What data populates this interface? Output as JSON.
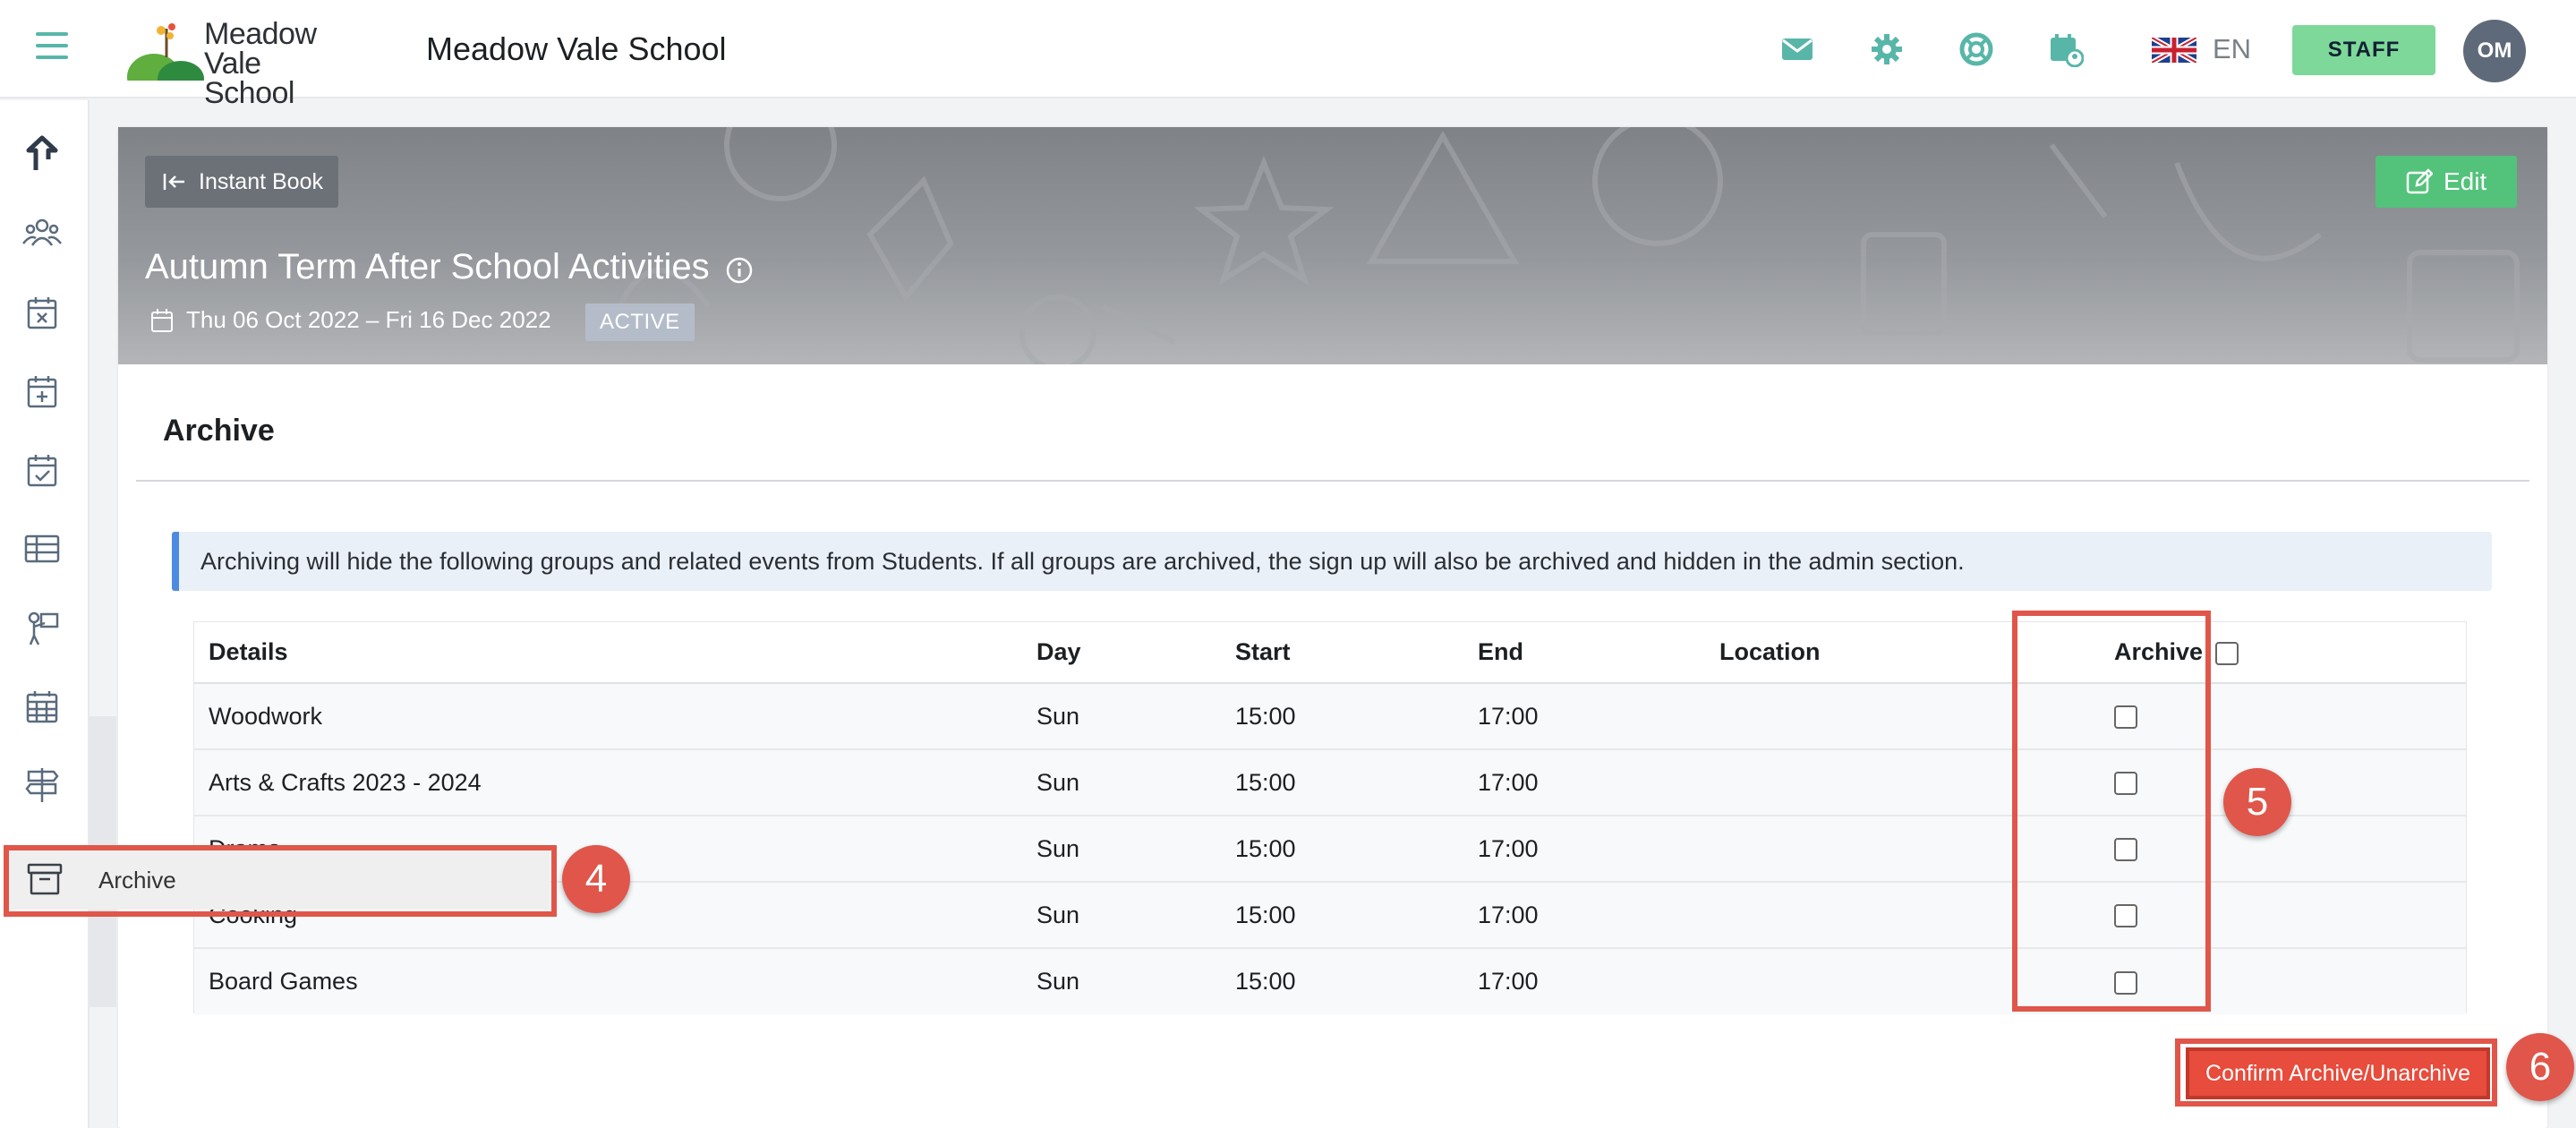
{
  "header": {
    "logo_line1": "Meadow",
    "logo_line2": "Vale School",
    "school_name": "Meadow Vale School",
    "language": "EN",
    "staff_label": "STAFF",
    "avatar_initials": "OM",
    "icons": [
      "menu-icon",
      "mail-icon",
      "gear-icon",
      "help-lifebuoy-icon",
      "calendar-user-icon",
      "uk-flag-icon"
    ]
  },
  "sidebar": {
    "icons": [
      "upload-arrow-icon",
      "users-icon",
      "calendar-x-icon",
      "calendar-plus-icon",
      "calendar-check-icon",
      "table-icon",
      "person-board-icon",
      "calendar-grid-icon",
      "signpost-icon",
      "archive-icon"
    ]
  },
  "banner": {
    "back_label": "Instant Book",
    "edit_label": "Edit",
    "title": "Autumn Term After School Activities",
    "date_range": "Thu 06 Oct 2022 – Fri 16 Dec 2022",
    "status": "ACTIVE"
  },
  "archive": {
    "section_title": "Archive",
    "notice": "Archiving will hide the following groups and related events from Students. If all groups are archived, the sign up will also be archived and hidden in the admin section.",
    "columns": [
      "Details",
      "Day",
      "Start",
      "End",
      "Location",
      "Archive"
    ],
    "rows": [
      {
        "details": "Woodwork",
        "day": "Sun",
        "start": "15:00",
        "end": "17:00",
        "location": "",
        "archived": false
      },
      {
        "details": "Arts & Crafts 2023 - 2024",
        "day": "Sun",
        "start": "15:00",
        "end": "17:00",
        "location": "",
        "archived": false
      },
      {
        "details": "Drama",
        "day": "Sun",
        "start": "15:00",
        "end": "17:00",
        "location": "",
        "archived": false
      },
      {
        "details": "Cooking",
        "day": "Sun",
        "start": "15:00",
        "end": "17:00",
        "location": "",
        "archived": false
      },
      {
        "details": "Board Games",
        "day": "Sun",
        "start": "15:00",
        "end": "17:00",
        "location": "",
        "archived": false
      }
    ],
    "confirm_label": "Confirm Archive/Unarchive"
  },
  "tooltip": {
    "archive_label": "Archive"
  },
  "annotations": {
    "step4": "4",
    "step5": "5",
    "step6": "6"
  },
  "colors": {
    "accent_teal": "#58b6a9",
    "staff_green": "#7ed89a",
    "edit_green": "#53c27a",
    "annotation_red": "#e0564a",
    "confirm_red": "#e74c3c",
    "info_blue": "#4b8ce2"
  }
}
